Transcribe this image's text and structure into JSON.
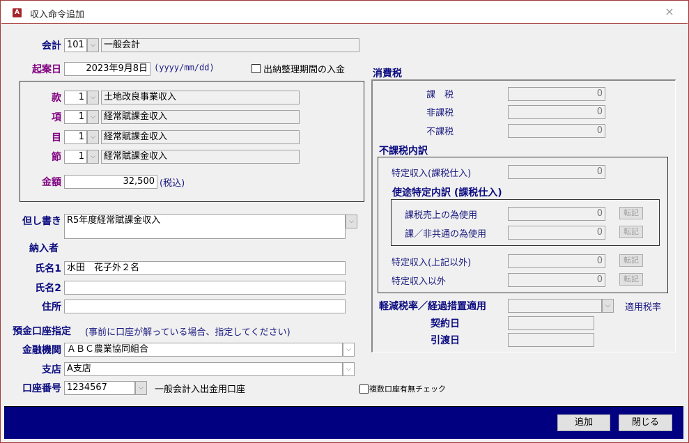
{
  "window": {
    "title": "収入命令追加",
    "app_icon": "A",
    "close_icon": "×"
  },
  "form": {
    "kaikei": {
      "label": "会計",
      "code": "101",
      "name": "一般会計"
    },
    "kiangbi": {
      "label": "起案日",
      "value": "2023年9月8日",
      "format_hint": "(yyyy/mm/dd)"
    },
    "suito_checkbox": {
      "label": "出納整理期間の入金",
      "checked": false
    },
    "budget": {
      "kan": {
        "label": "款",
        "code": "1",
        "name": "土地改良事業収入"
      },
      "kou": {
        "label": "項",
        "code": "1",
        "name": "経常賦課金収入"
      },
      "moku": {
        "label": "目",
        "code": "1",
        "name": "経常賦課金収入"
      },
      "setsu": {
        "label": "節",
        "code": "1",
        "name": "経常賦課金収入"
      },
      "amount": {
        "label": "金額",
        "value": "32,500",
        "note": "(税込)"
      }
    },
    "tadashigaki": {
      "label": "但し書き",
      "value": "R5年度経常賦課金収入"
    },
    "payer": {
      "section_label": "納入者",
      "name1": {
        "label": "氏名1",
        "value": "水田　花子外２名"
      },
      "name2": {
        "label": "氏名2",
        "value": ""
      },
      "address": {
        "label": "住所",
        "value": ""
      }
    },
    "bank": {
      "section_label": "預金口座指定",
      "section_note": "(事前に口座が解っている場合、指定してください)",
      "institution": {
        "label": "金融機関",
        "value": "ＡＢＣ農業協同組合"
      },
      "branch": {
        "label": "支店",
        "value": "A支店"
      },
      "account": {
        "label": "口座番号",
        "value": "1234567",
        "description": "一般会計入出金用口座"
      },
      "multi_check": {
        "label": "複数口座有無チェック",
        "checked": false
      }
    }
  },
  "tax": {
    "section_label": "消費税",
    "kazei": {
      "label": "課　税",
      "value": "0"
    },
    "hikazei": {
      "label": "非課税",
      "value": "0"
    },
    "fukazei": {
      "label": "不課税",
      "value": "0"
    },
    "breakdown": {
      "section_label": "不課税内訳",
      "tokutei_kazei": {
        "label": "特定収入(課税仕入)",
        "value": "0"
      },
      "usage": {
        "section_label": "使途特定内訳 (課税仕入)",
        "kazei_uriage": {
          "label": "課税売上の為使用",
          "value": "0",
          "button": "転記"
        },
        "kyoutsu": {
          "label": "課／非共通の為使用",
          "value": "0",
          "button": "転記"
        }
      },
      "tokutei_other": {
        "label": "特定収入(上記以外)",
        "value": "0",
        "button": "転記"
      },
      "tokutei_igai": {
        "label": "特定収入以外",
        "value": "0",
        "button": "転記"
      }
    },
    "reduced_rate": {
      "label": "軽減税率／経過措置適用",
      "value": "",
      "rate_label": "適用税率"
    },
    "contract_date": {
      "label": "契約日",
      "value": ""
    },
    "delivery_date": {
      "label": "引渡日",
      "value": ""
    }
  },
  "footer": {
    "add_label": "追加",
    "close_label": "閉じる"
  },
  "icons": {
    "dropdown": "⌵",
    "checkbox_empty": ""
  }
}
